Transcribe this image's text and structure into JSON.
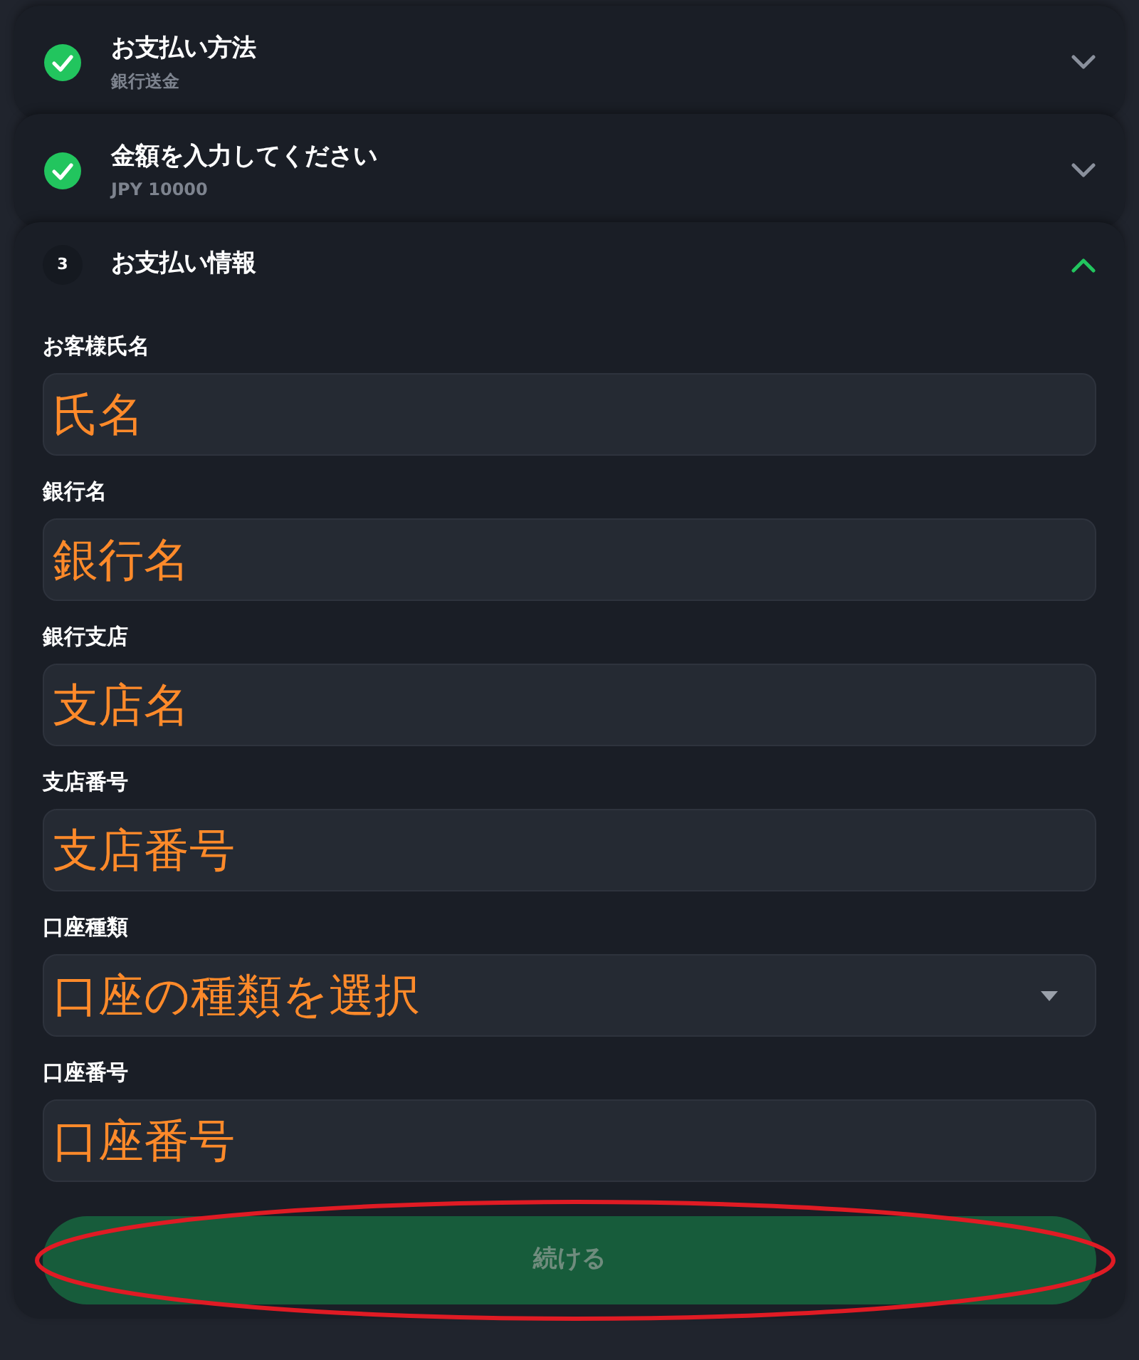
{
  "steps": [
    {
      "kind": "done",
      "title": "お支払い方法",
      "subtitle": "銀行送金",
      "expanded": false
    },
    {
      "kind": "done",
      "title": "金額を入力してください",
      "subtitle": "JPY 10000",
      "expanded": false
    },
    {
      "kind": "number",
      "number": "3",
      "title": "お支払い情報",
      "expanded": true
    }
  ],
  "fields": [
    {
      "kind": "text",
      "label": "お客様氏名",
      "value": "氏名"
    },
    {
      "kind": "text",
      "label": "銀行名",
      "value": "銀行名"
    },
    {
      "kind": "text",
      "label": "銀行支店",
      "value": "支店名"
    },
    {
      "kind": "text",
      "label": "支店番号",
      "value": "支店番号"
    },
    {
      "kind": "select",
      "label": "口座種類",
      "value": "口座の種類を選択"
    },
    {
      "kind": "text",
      "label": "口座番号",
      "value": "口座番号"
    }
  ],
  "continue_button": {
    "label": "続ける",
    "disabled": true,
    "highlighted": true
  }
}
